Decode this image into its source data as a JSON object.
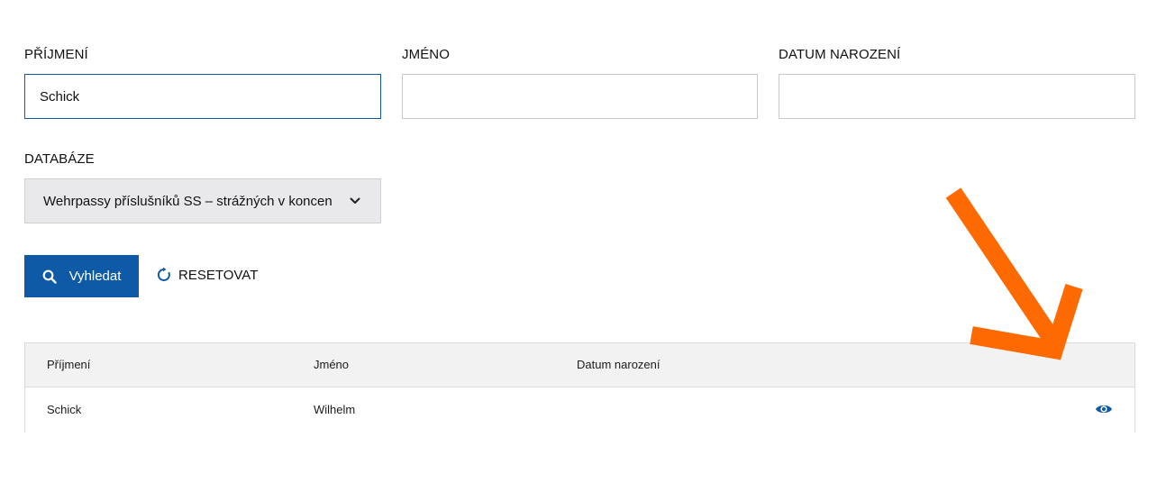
{
  "form": {
    "surname": {
      "label": "PŘÍJMENÍ",
      "value": "Schick",
      "placeholder": ""
    },
    "firstname": {
      "label": "JMÉNO",
      "value": "",
      "placeholder": ""
    },
    "birthdate": {
      "label": "DATUM NAROZENÍ",
      "value": "",
      "placeholder": ""
    },
    "database": {
      "label": "DATABÁZE",
      "selected": "Wehrpassy příslušníků SS – strážných v koncentračních táborech"
    }
  },
  "actions": {
    "search_label": "Vyhledat",
    "reset_label": "RESETOVAT"
  },
  "table": {
    "headers": [
      "Příjmení",
      "Jméno",
      "Datum narození"
    ],
    "rows": [
      {
        "surname": "Schick",
        "firstname": "Wilhelm",
        "birthdate": ""
      }
    ]
  },
  "icons": {
    "search": "search-icon",
    "reset": "refresh-icon",
    "view": "eye-icon",
    "dropdown": "chevron-down-icon",
    "annotation": "arrow-annotation"
  },
  "colors": {
    "primary": "#0e5aa7",
    "annotation": "#ff6a00",
    "header_bg": "#f2f2f2",
    "select_bg": "#e9e9ec"
  }
}
